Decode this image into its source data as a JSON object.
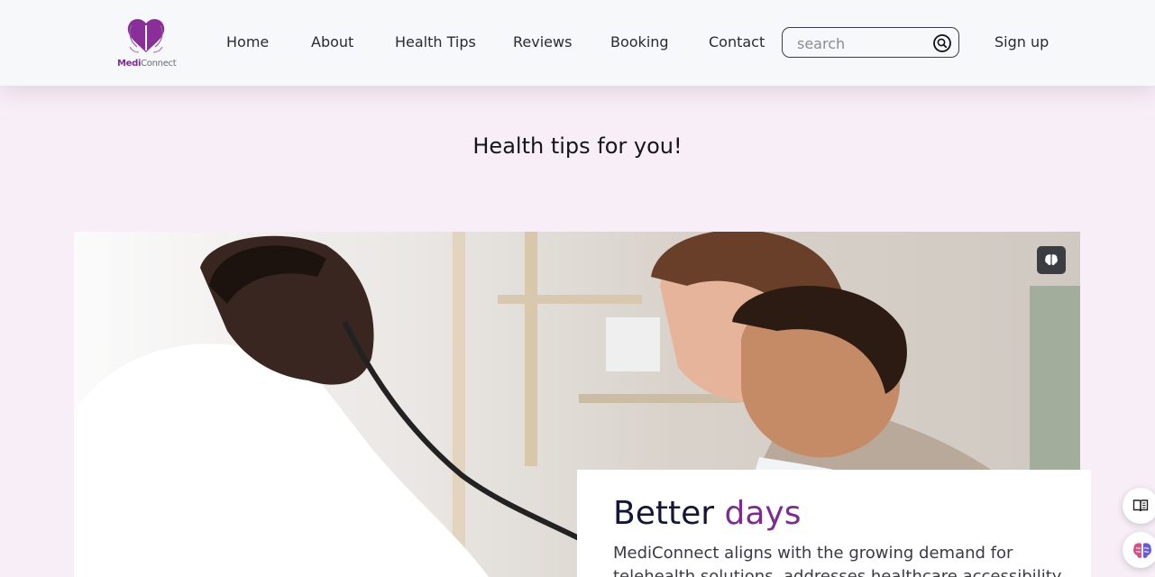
{
  "brand": {
    "name_part1": "Medi",
    "name_part2": "Connect"
  },
  "nav": {
    "home": "Home",
    "about": "About",
    "health_tips": "Health Tips",
    "reviews": "Reviews",
    "booking": "Booking",
    "contact": "Contact",
    "signup": "Sign up"
  },
  "search": {
    "placeholder": "search",
    "value": ""
  },
  "section": {
    "title": "Health tips for you!"
  },
  "card": {
    "title_main": "Better",
    "title_accent": "days",
    "text": "MediConnect aligns with the growing demand for telehealth solutions, addresses healthcare accessibility"
  },
  "colors": {
    "brand": "#7b2d8e",
    "background": "#f7eef7",
    "header": "#f6f8fa",
    "title_dark": "#15153a"
  },
  "icons": {
    "logo": "brain-heart-logo",
    "search": "search-circle-icon",
    "hero_badge": "brain-icon",
    "reader": "open-book-icon",
    "ai": "colorful-brain-icon"
  }
}
